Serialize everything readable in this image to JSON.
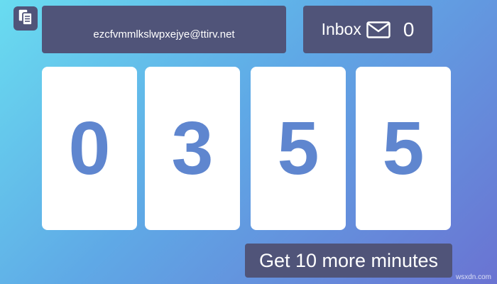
{
  "email": {
    "address": "ezcfvmmlkslwpxejye@ttirv.net",
    "copy_icon": "copy-icon"
  },
  "inbox": {
    "label": "Inbox",
    "icon": "envelope-icon",
    "count": "0"
  },
  "timer": {
    "digits": [
      "0",
      "3",
      "5",
      "5"
    ]
  },
  "extend_button": {
    "label": "Get 10 more minutes"
  },
  "watermark": "wsxdn.com",
  "colors": {
    "panel": "#505479",
    "digit": "#5f86cf",
    "card": "#ffffff"
  }
}
